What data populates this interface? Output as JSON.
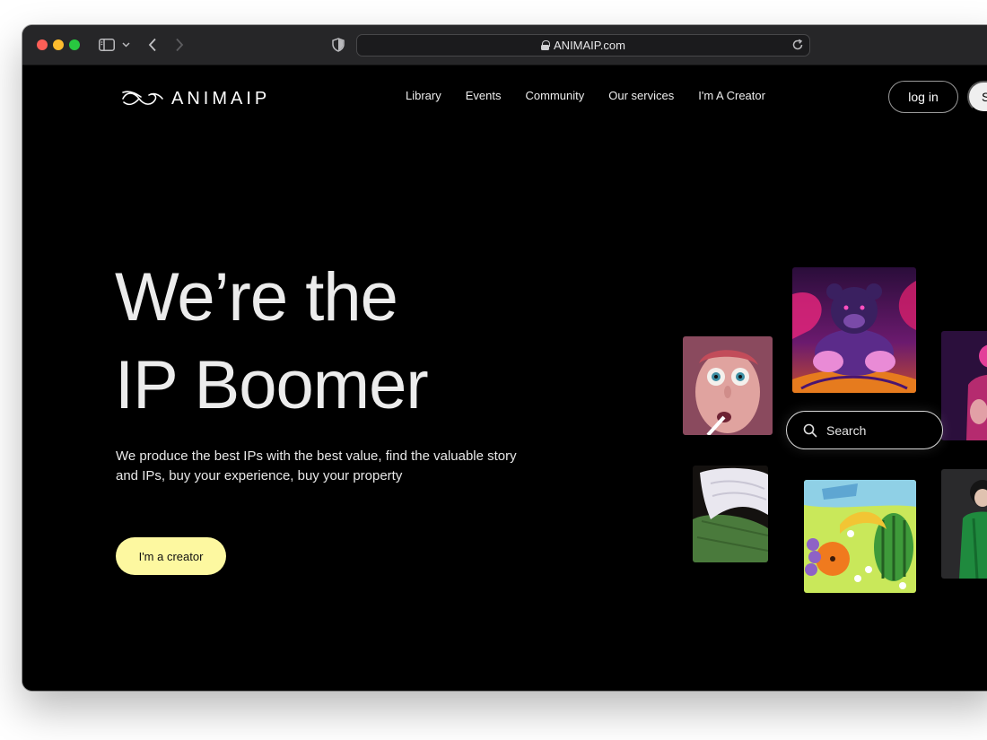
{
  "browser": {
    "url": "ANIMAIP.com"
  },
  "header": {
    "logo_text": "ANIMAIP",
    "nav": [
      {
        "label": "Library"
      },
      {
        "label": "Events"
      },
      {
        "label": "Community"
      },
      {
        "label": "Our services"
      },
      {
        "label": "I'm A Creator"
      }
    ],
    "login_label": "log in",
    "signup_label": "S"
  },
  "hero": {
    "title_line1": "We’re the",
    "title_line2": "IP Boomer",
    "description": "We produce the best IPs with the best value, find the valuable story and IPs, buy your experience, buy your property",
    "cta_label": "I'm a creator"
  },
  "gallery": {
    "search_label": "Search"
  },
  "colors": {
    "page_background": "#000000",
    "cta_background": "#fdf8a0",
    "titlebar": "#262628"
  }
}
